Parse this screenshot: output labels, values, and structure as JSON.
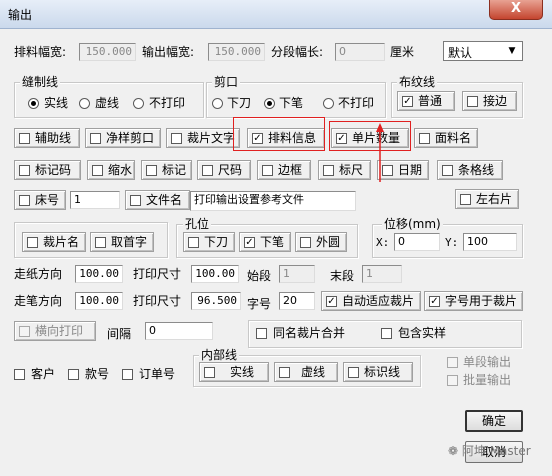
{
  "window": {
    "title": "输出",
    "close_label": "X"
  },
  "row1": {
    "layout_width_label": "排料幅宽:",
    "layout_width_value": "150.000",
    "output_width_label": "输出幅宽:",
    "output_width_value": "150.000",
    "segment_length_label": "分段幅长:",
    "segment_length_value": "0",
    "unit_label": "厘米",
    "preset_selected": "默认"
  },
  "sewing_line": {
    "title": "缝制线",
    "options": [
      "实线",
      "虚线",
      "不打印"
    ],
    "selected": "实线"
  },
  "notch": {
    "title": "剪口",
    "options": [
      "下刀",
      "下笔",
      "不打印"
    ],
    "selected": "下笔"
  },
  "grain_line": {
    "title": "布纹线",
    "options": [
      {
        "label": "普通",
        "checked": true
      },
      {
        "label": "接边",
        "checked": false
      }
    ]
  },
  "row_a": [
    {
      "label": "辅助线",
      "checked": false
    },
    {
      "label": "净样剪口",
      "checked": false
    },
    {
      "label": "裁片文字",
      "checked": false
    },
    {
      "label": "排料信息",
      "checked": true
    },
    {
      "label": "单片数量",
      "checked": true
    },
    {
      "label": "面料名",
      "checked": false
    }
  ],
  "row_b": [
    {
      "label": "标记码",
      "checked": false
    },
    {
      "label": "缩水",
      "checked": false
    },
    {
      "label": "标记",
      "checked": false
    },
    {
      "label": "尺码",
      "checked": false
    },
    {
      "label": "边框",
      "checked": false
    },
    {
      "label": "标尺",
      "checked": false
    },
    {
      "label": "日期",
      "checked": false
    },
    {
      "label": "条格线",
      "checked": false
    }
  ],
  "row_c": {
    "bed_label": "床号",
    "bed_value": "1",
    "filename_label": "文件名",
    "filename_value": "打印输出设置参考文件",
    "left_right_label": "左右片"
  },
  "row_d": {
    "piece_name_label": "裁片名",
    "head_char_label": "取首字",
    "hole_title": "孔位",
    "hole_options": [
      {
        "label": "下刀",
        "checked": false
      },
      {
        "label": "下笔",
        "checked": true
      },
      {
        "label": "外圆",
        "checked": false
      }
    ],
    "offset_title": "位移(mm)",
    "x_label": "X:",
    "x_value": "0",
    "y_label": "Y:",
    "y_value": "100"
  },
  "paper": {
    "paper_dir_label": "走纸方向",
    "paper_dir_value": "100.00",
    "print_size_label": "打印尺寸",
    "print_size_value": "100.00",
    "start_label": "始段",
    "start_value": "1",
    "end_label": "末段",
    "end_value": "1"
  },
  "pen": {
    "pen_dir_label": "走笔方向",
    "pen_dir_value": "100.00",
    "print_size_label": "打印尺寸",
    "print_size_value": "96.500",
    "font_size_label": "字号",
    "font_size_value": "20",
    "auto_fit_label": "自动适应裁片",
    "font_for_piece_label": "字号用于裁片"
  },
  "row_g": {
    "horizontal_print_label": "横向打印",
    "gap_label": "间隔",
    "gap_value": "0",
    "merge_label": "同名裁片合并",
    "include_sample_label": "包含实样"
  },
  "inner_line": {
    "title": "内部线",
    "options": [
      "实线",
      "虚线",
      "标识线"
    ]
  },
  "row_h": {
    "customer_label": "客户",
    "style_label": "款号",
    "order_label": "订单号",
    "single_output_label": "单段输出",
    "batch_output_label": "批量输出"
  },
  "buttons": {
    "ok_label": "确定",
    "cancel_label": "取消"
  },
  "watermark": "阿坤 Master"
}
